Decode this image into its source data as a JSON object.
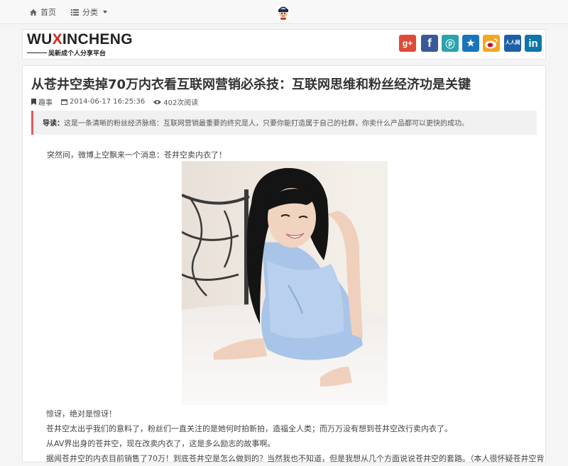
{
  "nav": {
    "home_label": "首页",
    "category_label": "分类"
  },
  "logo": {
    "main_a": "WU",
    "main_b": "X",
    "main_c": "INCHENG",
    "tagline": "吴新成个人分享平台"
  },
  "social": [
    {
      "name": "google-plus",
      "glyph": "g+",
      "color": "#dd4b39"
    },
    {
      "name": "facebook",
      "glyph": "f",
      "color": "#3b5998"
    },
    {
      "name": "p",
      "glyph": "ⓟ",
      "color": "#2ba3ab"
    },
    {
      "name": "star",
      "glyph": "★",
      "color": "#1b74b9"
    },
    {
      "name": "weibo",
      "glyph": "微",
      "color": "#f5a623"
    },
    {
      "name": "renren",
      "glyph": "人人网",
      "color": "#1f5fa6"
    },
    {
      "name": "linkedin",
      "glyph": "in",
      "color": "#0e76a8"
    }
  ],
  "article": {
    "title": "从苍井空卖掉70万内衣看互联网营销必杀技：互联网思维和粉丝经济功是关键",
    "category": "趣事",
    "date": "2014-06-17 16:25:36",
    "views": "402次阅读",
    "lead_label": "导读：",
    "lead_text": "这是一条清晰的粉丝经济脉络：互联网营销最重要的终究是人，只要你能打造属于自己的社群，你卖什么产品都可以更快的成功。",
    "p1": "突然间，微博上空飘来一个消息：苍井空卖内衣了！",
    "lines": [
      "惊讶，绝对是惊讶！",
      "苍井空太出乎我们的意料了，粉丝们一直关注的是她何时拍新拍，造福全人类；而万万没有想到苍井空改行卖内衣了。",
      "从AV界出身的苍井空，现在改卖内衣了，这是多么励志的故事啊。",
      "据闻苍井空的内衣目前销售了70万！到底苍井空是怎么做到的？当然我也不知道，但是我想从几个方面说说苍井空的套路。（本人很怀疑苍井空背"
    ]
  },
  "colors": {
    "brand_red": "#d9261c",
    "lead_border": "#e25c5c"
  }
}
